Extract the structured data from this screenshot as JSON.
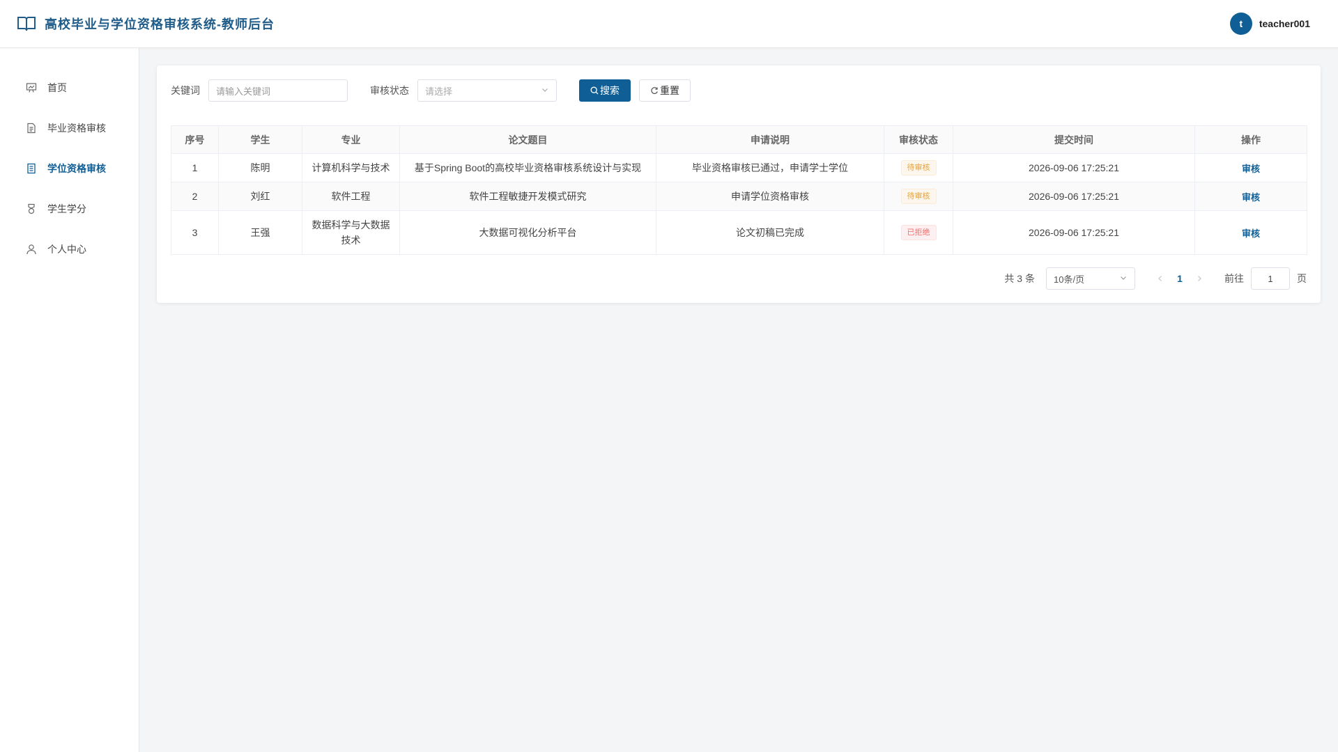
{
  "header": {
    "title": "高校毕业与学位资格审核系统-教师后台",
    "user": {
      "avatar_letter": "t",
      "name": "teacher001"
    }
  },
  "sidebar": {
    "items": [
      {
        "label": "首页",
        "icon": "presentation-icon",
        "active": false
      },
      {
        "label": "毕业资格审核",
        "icon": "document-icon",
        "active": false
      },
      {
        "label": "学位资格审核",
        "icon": "document-list-icon",
        "active": true
      },
      {
        "label": "学生学分",
        "icon": "medal-icon",
        "active": false
      },
      {
        "label": "个人中心",
        "icon": "user-icon",
        "active": false
      }
    ]
  },
  "filters": {
    "keyword_label": "关键词",
    "keyword_placeholder": "请输入关键词",
    "status_label": "审核状态",
    "status_placeholder": "请选择",
    "search_label": "搜索",
    "reset_label": "重置"
  },
  "table": {
    "columns": [
      "序号",
      "学生",
      "专业",
      "论文题目",
      "申请说明",
      "审核状态",
      "提交时间",
      "操作"
    ],
    "rows": [
      {
        "index": "1",
        "student": "陈明",
        "major": "计算机科学与技术",
        "thesis": "基于Spring Boot的高校毕业资格审核系统设计与实现",
        "note": "毕业资格审核已通过，申请学士学位",
        "status": "待审核",
        "status_type": "warning",
        "time": "2026-09-06 17:25:21",
        "action": "审核"
      },
      {
        "index": "2",
        "student": "刘红",
        "major": "软件工程",
        "thesis": "软件工程敏捷开发模式研究",
        "note": "申请学位资格审核",
        "status": "待审核",
        "status_type": "warning",
        "time": "2026-09-06 17:25:21",
        "action": "审核"
      },
      {
        "index": "3",
        "student": "王强",
        "major": "数据科学与大数据技术",
        "thesis": "大数据可视化分析平台",
        "note": "论文初稿已完成",
        "status": "已拒绝",
        "status_type": "danger",
        "time": "2026-09-06 17:25:21",
        "action": "审核"
      }
    ]
  },
  "pagination": {
    "total_text": "共 3 条",
    "page_size": "10条/页",
    "current_page": "1",
    "goto_label": "前往",
    "goto_value": "1",
    "page_suffix": "页"
  },
  "colors": {
    "primary": "#0f5f96",
    "warning": "#e6a23c",
    "danger": "#f56c6c"
  }
}
